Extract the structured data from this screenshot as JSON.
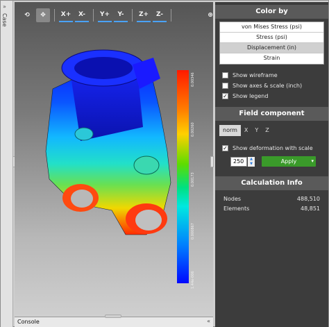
{
  "left_strip": {
    "label": "Case",
    "chevron_icon": "double-chevron-right-icon"
  },
  "toolbar": {
    "icons": [
      "rotate-icon",
      "pan-icon",
      "zoom-in-icon",
      "zoom-out-icon"
    ],
    "axes": [
      "X+",
      "X-",
      "Y+",
      "Y-",
      "Z+",
      "Z-"
    ]
  },
  "legend": {
    "ticks": [
      "0.00346",
      "0.00260",
      "0.00173",
      "0.000867",
      "1.44e-006"
    ],
    "colors": {
      "max": "#ff1a00",
      "min": "#0008ff"
    }
  },
  "console": {
    "label": "Console",
    "expand_icon": "double-chevron-up-icon"
  },
  "panel": {
    "color_by": {
      "title": "Color by",
      "options": [
        "von Mises Stress (psi)",
        "Stress (psi)",
        "Displacement (in)",
        "Strain"
      ],
      "selected": "Displacement (in)"
    },
    "options": [
      {
        "label": "Show wireframe",
        "checked": false
      },
      {
        "label": "Show axes & scale (inch)",
        "checked": false
      },
      {
        "label": "Show legend",
        "checked": true
      }
    ],
    "field_component": {
      "title": "Field component",
      "tabs": [
        "norm",
        "X",
        "Y",
        "Z"
      ],
      "selected": "norm"
    },
    "deformation": {
      "label": "Show deformation with scale",
      "checked": true,
      "scale": "250",
      "apply_label": "Apply"
    },
    "calc_info": {
      "title": "Calculation Info",
      "rows": [
        {
          "label": "Nodes",
          "value": "488,510"
        },
        {
          "label": "Elements",
          "value": "48,851"
        }
      ]
    }
  },
  "colors": {
    "panel_bg": "#3c3c3c",
    "apply_green": "#3a9a2a",
    "header_bg": "#5a5a5a"
  }
}
